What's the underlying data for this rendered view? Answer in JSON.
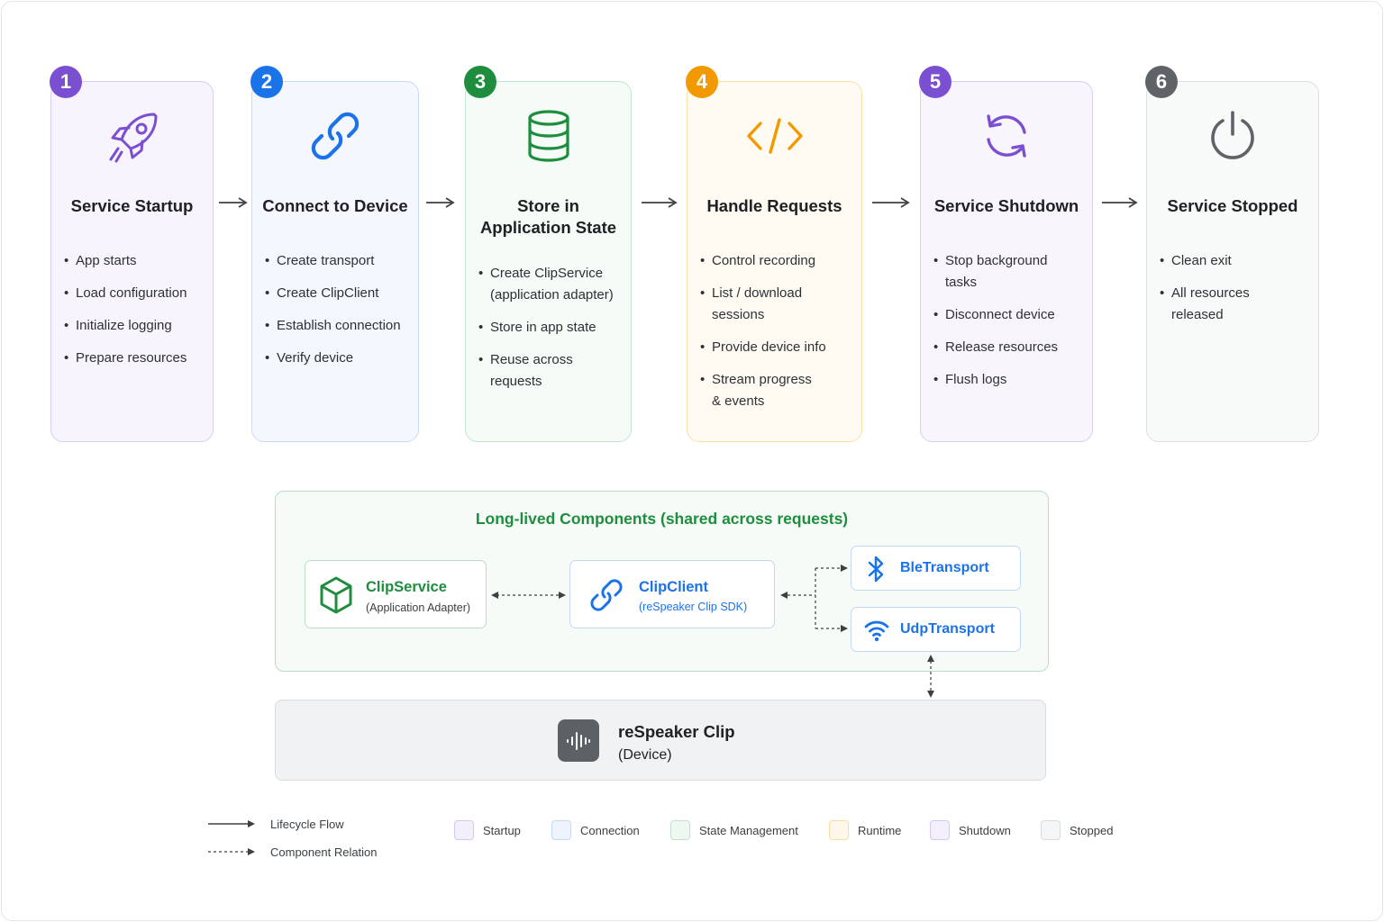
{
  "stages": [
    {
      "number": "1",
      "title_lines": [
        "Service Startup"
      ],
      "bullets": [
        [
          "App starts"
        ],
        [
          "Load configuration"
        ],
        [
          "Initialize logging"
        ],
        [
          "Prepare resources"
        ]
      ],
      "icon": "rocket-icon",
      "accent": "#7b4fd1",
      "bg": "#f7f4fd",
      "border": "#d8cdf3"
    },
    {
      "number": "2",
      "title_lines": [
        "Connect to Device"
      ],
      "bullets": [
        [
          "Create transport"
        ],
        [
          "Create ClipClient"
        ],
        [
          "Establish connection"
        ],
        [
          "Verify device"
        ]
      ],
      "icon": "link-icon",
      "accent": "#1a73e8",
      "bg": "#f4f8fe",
      "border": "#c6dbf7"
    },
    {
      "number": "3",
      "title_lines": [
        "Store in",
        "Application State"
      ],
      "bullets": [
        [
          "Create ClipService",
          "(application adapter)"
        ],
        [
          "Store in app state"
        ],
        [
          "Reuse across",
          "requests"
        ]
      ],
      "icon": "database-icon",
      "accent": "#1e8e3e",
      "bg": "#f5fbf6",
      "border": "#c4e4cd"
    },
    {
      "number": "4",
      "title_lines": [
        "Handle Requests"
      ],
      "bullets": [
        [
          "Control recording"
        ],
        [
          "List / download",
          "sessions"
        ],
        [
          "Provide device info"
        ],
        [
          "Stream progress",
          "& events"
        ]
      ],
      "icon": "code-icon",
      "accent": "#f29900",
      "bg": "#fffbf2",
      "border": "#f9dfa8"
    },
    {
      "number": "5",
      "title_lines": [
        "Service Shutdown"
      ],
      "bullets": [
        [
          "Stop background",
          "tasks"
        ],
        [
          "Disconnect device"
        ],
        [
          "Release resources"
        ],
        [
          "Flush logs"
        ]
      ],
      "icon": "refresh-icon",
      "accent": "#7b4fd1",
      "bg": "#f8f5fd",
      "border": "#d8cdf3"
    },
    {
      "number": "6",
      "title_lines": [
        "Service Stopped"
      ],
      "bullets": [
        [
          "Clean exit"
        ],
        [
          "All resources",
          "released"
        ]
      ],
      "icon": "power-icon",
      "accent": "#5f6368",
      "bg": "#f8f9f9",
      "border": "#dcdfe2"
    }
  ],
  "components": {
    "title": "Long-lived Components (shared across requests)",
    "clip_service": {
      "name": "ClipService",
      "sub": "(Application Adapter)",
      "icon": "cube-icon",
      "color": "#1e8e3e"
    },
    "clip_client": {
      "name": "ClipClient",
      "sub": "(reSpeaker Clip SDK)",
      "icon": "link-icon",
      "color": "#1a73e8"
    },
    "ble": {
      "name": "BleTransport",
      "icon": "bluetooth-icon",
      "color": "#1a73e8"
    },
    "udp": {
      "name": "UdpTransport",
      "icon": "wifi-icon",
      "color": "#1a73e8"
    }
  },
  "device": {
    "name": "reSpeaker Clip",
    "sub": "(Device)",
    "icon": "waveform-icon"
  },
  "legend": {
    "lines": [
      {
        "label": "Lifecycle Flow",
        "style": "solid"
      },
      {
        "label": "Component Relation",
        "style": "dashed"
      }
    ],
    "swatches": [
      {
        "label": "Startup",
        "bg": "#f3effd",
        "border": "#d4c7f3"
      },
      {
        "label": "Connection",
        "bg": "#eef4fe",
        "border": "#c3d8f6"
      },
      {
        "label": "State Management",
        "bg": "#eef8f1",
        "border": "#c0e2ca"
      },
      {
        "label": "Runtime",
        "bg": "#fff8ea",
        "border": "#f7dca3"
      },
      {
        "label": "Shutdown",
        "bg": "#f3effd",
        "border": "#d4c7f3"
      },
      {
        "label": "Stopped",
        "bg": "#f4f5f6",
        "border": "#d9dcdf"
      }
    ]
  }
}
